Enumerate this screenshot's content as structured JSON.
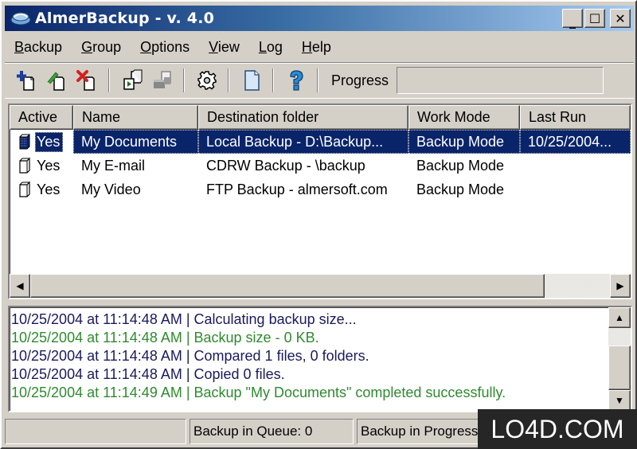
{
  "window": {
    "title": "AlmerBackup - v. 4.0",
    "controls": {
      "minimize": "_",
      "maximize": "☐",
      "close": "✕"
    }
  },
  "menu": [
    {
      "label": "Backup",
      "accel": "B",
      "rest": "ackup"
    },
    {
      "label": "Group",
      "accel": "G",
      "rest": "roup"
    },
    {
      "label": "Options",
      "accel": "O",
      "rest": "ptions"
    },
    {
      "label": "View",
      "accel": "V",
      "rest": "iew"
    },
    {
      "label": "Log",
      "accel": "L",
      "rest": "og"
    },
    {
      "label": "Help",
      "accel": "H",
      "rest": "elp"
    }
  ],
  "toolbar": {
    "buttons": [
      {
        "name": "add-backup",
        "icon": "add-icon"
      },
      {
        "name": "edit-backup",
        "icon": "edit-icon"
      },
      {
        "name": "delete-backup",
        "icon": "delete-icon"
      },
      {
        "name": "run-backup",
        "icon": "run-icon"
      },
      {
        "name": "run-all-backups",
        "icon": "run-all-icon",
        "disabled": true
      },
      {
        "name": "settings",
        "icon": "gear-icon"
      },
      {
        "name": "view-log",
        "icon": "document-icon"
      },
      {
        "name": "help",
        "icon": "help-icon"
      }
    ],
    "progress_label": "Progress",
    "progress_value": 0
  },
  "list": {
    "columns": [
      "Active",
      "Name",
      "Destination folder",
      "Work Mode",
      "Last Run"
    ],
    "rows": [
      {
        "active": "Yes",
        "name": "My Documents",
        "destination": "Local Backup - D:\\Backup...",
        "mode": "Backup Mode",
        "last_run": "10/25/2004...",
        "selected": true
      },
      {
        "active": "Yes",
        "name": "My E-mail",
        "destination": "CDRW Backup - \\backup",
        "mode": "Backup Mode",
        "last_run": "",
        "selected": false
      },
      {
        "active": "Yes",
        "name": "My Video",
        "destination": "FTP Backup - almersoft.com",
        "mode": "Backup Mode",
        "last_run": "",
        "selected": false
      }
    ]
  },
  "log": {
    "colors": {
      "info": "#1a1a5e",
      "success": "#2e8b2e"
    },
    "lines": [
      {
        "text": "10/25/2004 at 11:14:48 AM | Calculating backup size...",
        "type": "info"
      },
      {
        "text": "10/25/2004 at 11:14:48 AM | Backup size - 0 KB.",
        "type": "success"
      },
      {
        "text": "10/25/2004 at 11:14:48 AM | Compared 1 files, 0 folders.",
        "type": "info"
      },
      {
        "text": "10/25/2004 at 11:14:48 AM | Copied 0 files.",
        "type": "info"
      },
      {
        "text": "10/25/2004 at 11:14:49 AM | Backup \"My Documents\" completed successfully.",
        "type": "success"
      }
    ]
  },
  "statusbar": {
    "panel1": "",
    "queue": "Backup in Queue: 0",
    "progress": "Backup in Progress: None"
  },
  "watermark": "LO4D.COM"
}
